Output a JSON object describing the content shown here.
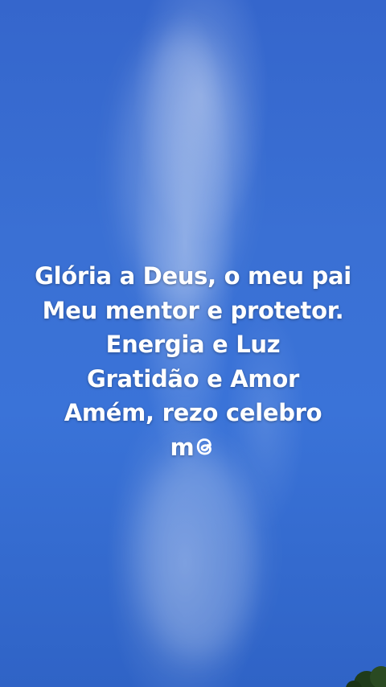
{
  "caption": {
    "lines": [
      "Glória a Deus, o meu pai",
      "Meu mentor e protetor.",
      "Energia e Luz",
      "Gratidão e Amor",
      "Amém, rezo celebro"
    ],
    "last_line_text": "m",
    "last_line_icon": "threads-icon"
  },
  "colors": {
    "sky": "#3a70d4",
    "text": "#ffffff"
  }
}
